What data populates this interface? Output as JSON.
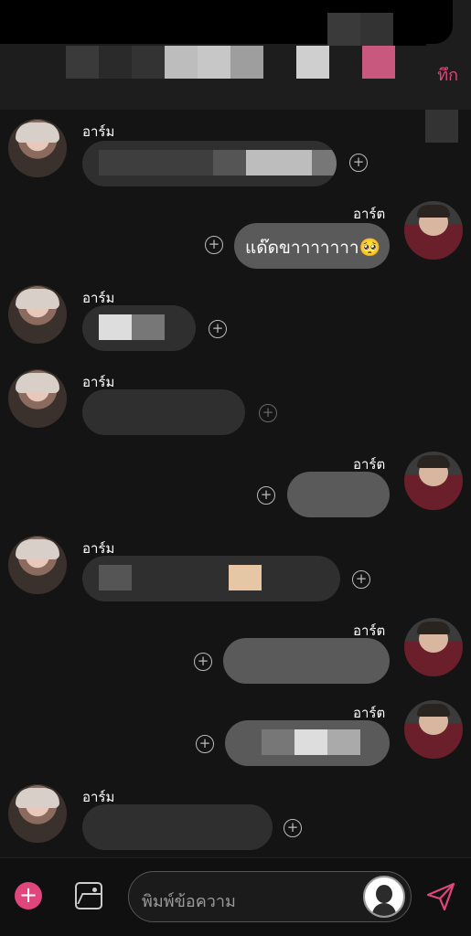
{
  "header": {
    "link_label": "ทึก",
    "top_blocks": [
      "#3a3a3a",
      "#2a2a2a",
      "#333333",
      "#bdbdbd",
      "#c7c7c7",
      "#9e9e9e",
      "#1d1d1d",
      "#cfcfcf",
      "#1d1d1d",
      "#c9587e"
    ],
    "strip_blocks": [
      "#3a3a3a",
      "#333333",
      "#000000"
    ]
  },
  "messages": [
    {
      "side": "in",
      "name": "อาร์ม",
      "text": ""
    },
    {
      "side": "out",
      "name": "อาร์ต",
      "text": "แด๊ดขาาาาาาา🥺"
    },
    {
      "side": "in",
      "name": "อาร์ม",
      "text": ""
    },
    {
      "side": "in",
      "name": "อาร์ม",
      "text": ""
    },
    {
      "side": "out",
      "name": "อาร์ต",
      "text": ""
    },
    {
      "side": "in",
      "name": "อาร์ม",
      "text": ""
    },
    {
      "side": "out",
      "name": "อาร์ต",
      "text": ""
    },
    {
      "side": "out",
      "name": "อาร์ต",
      "text": ""
    },
    {
      "side": "in",
      "name": "อาร์ม",
      "text": ""
    }
  ],
  "composer": {
    "placeholder": "พิมพ์ข้อความ",
    "add_icon": "plus-icon",
    "gallery_icon": "image-icon",
    "send_icon": "send-icon"
  },
  "colors": {
    "accent": "#e0457b",
    "background": "#141414"
  }
}
